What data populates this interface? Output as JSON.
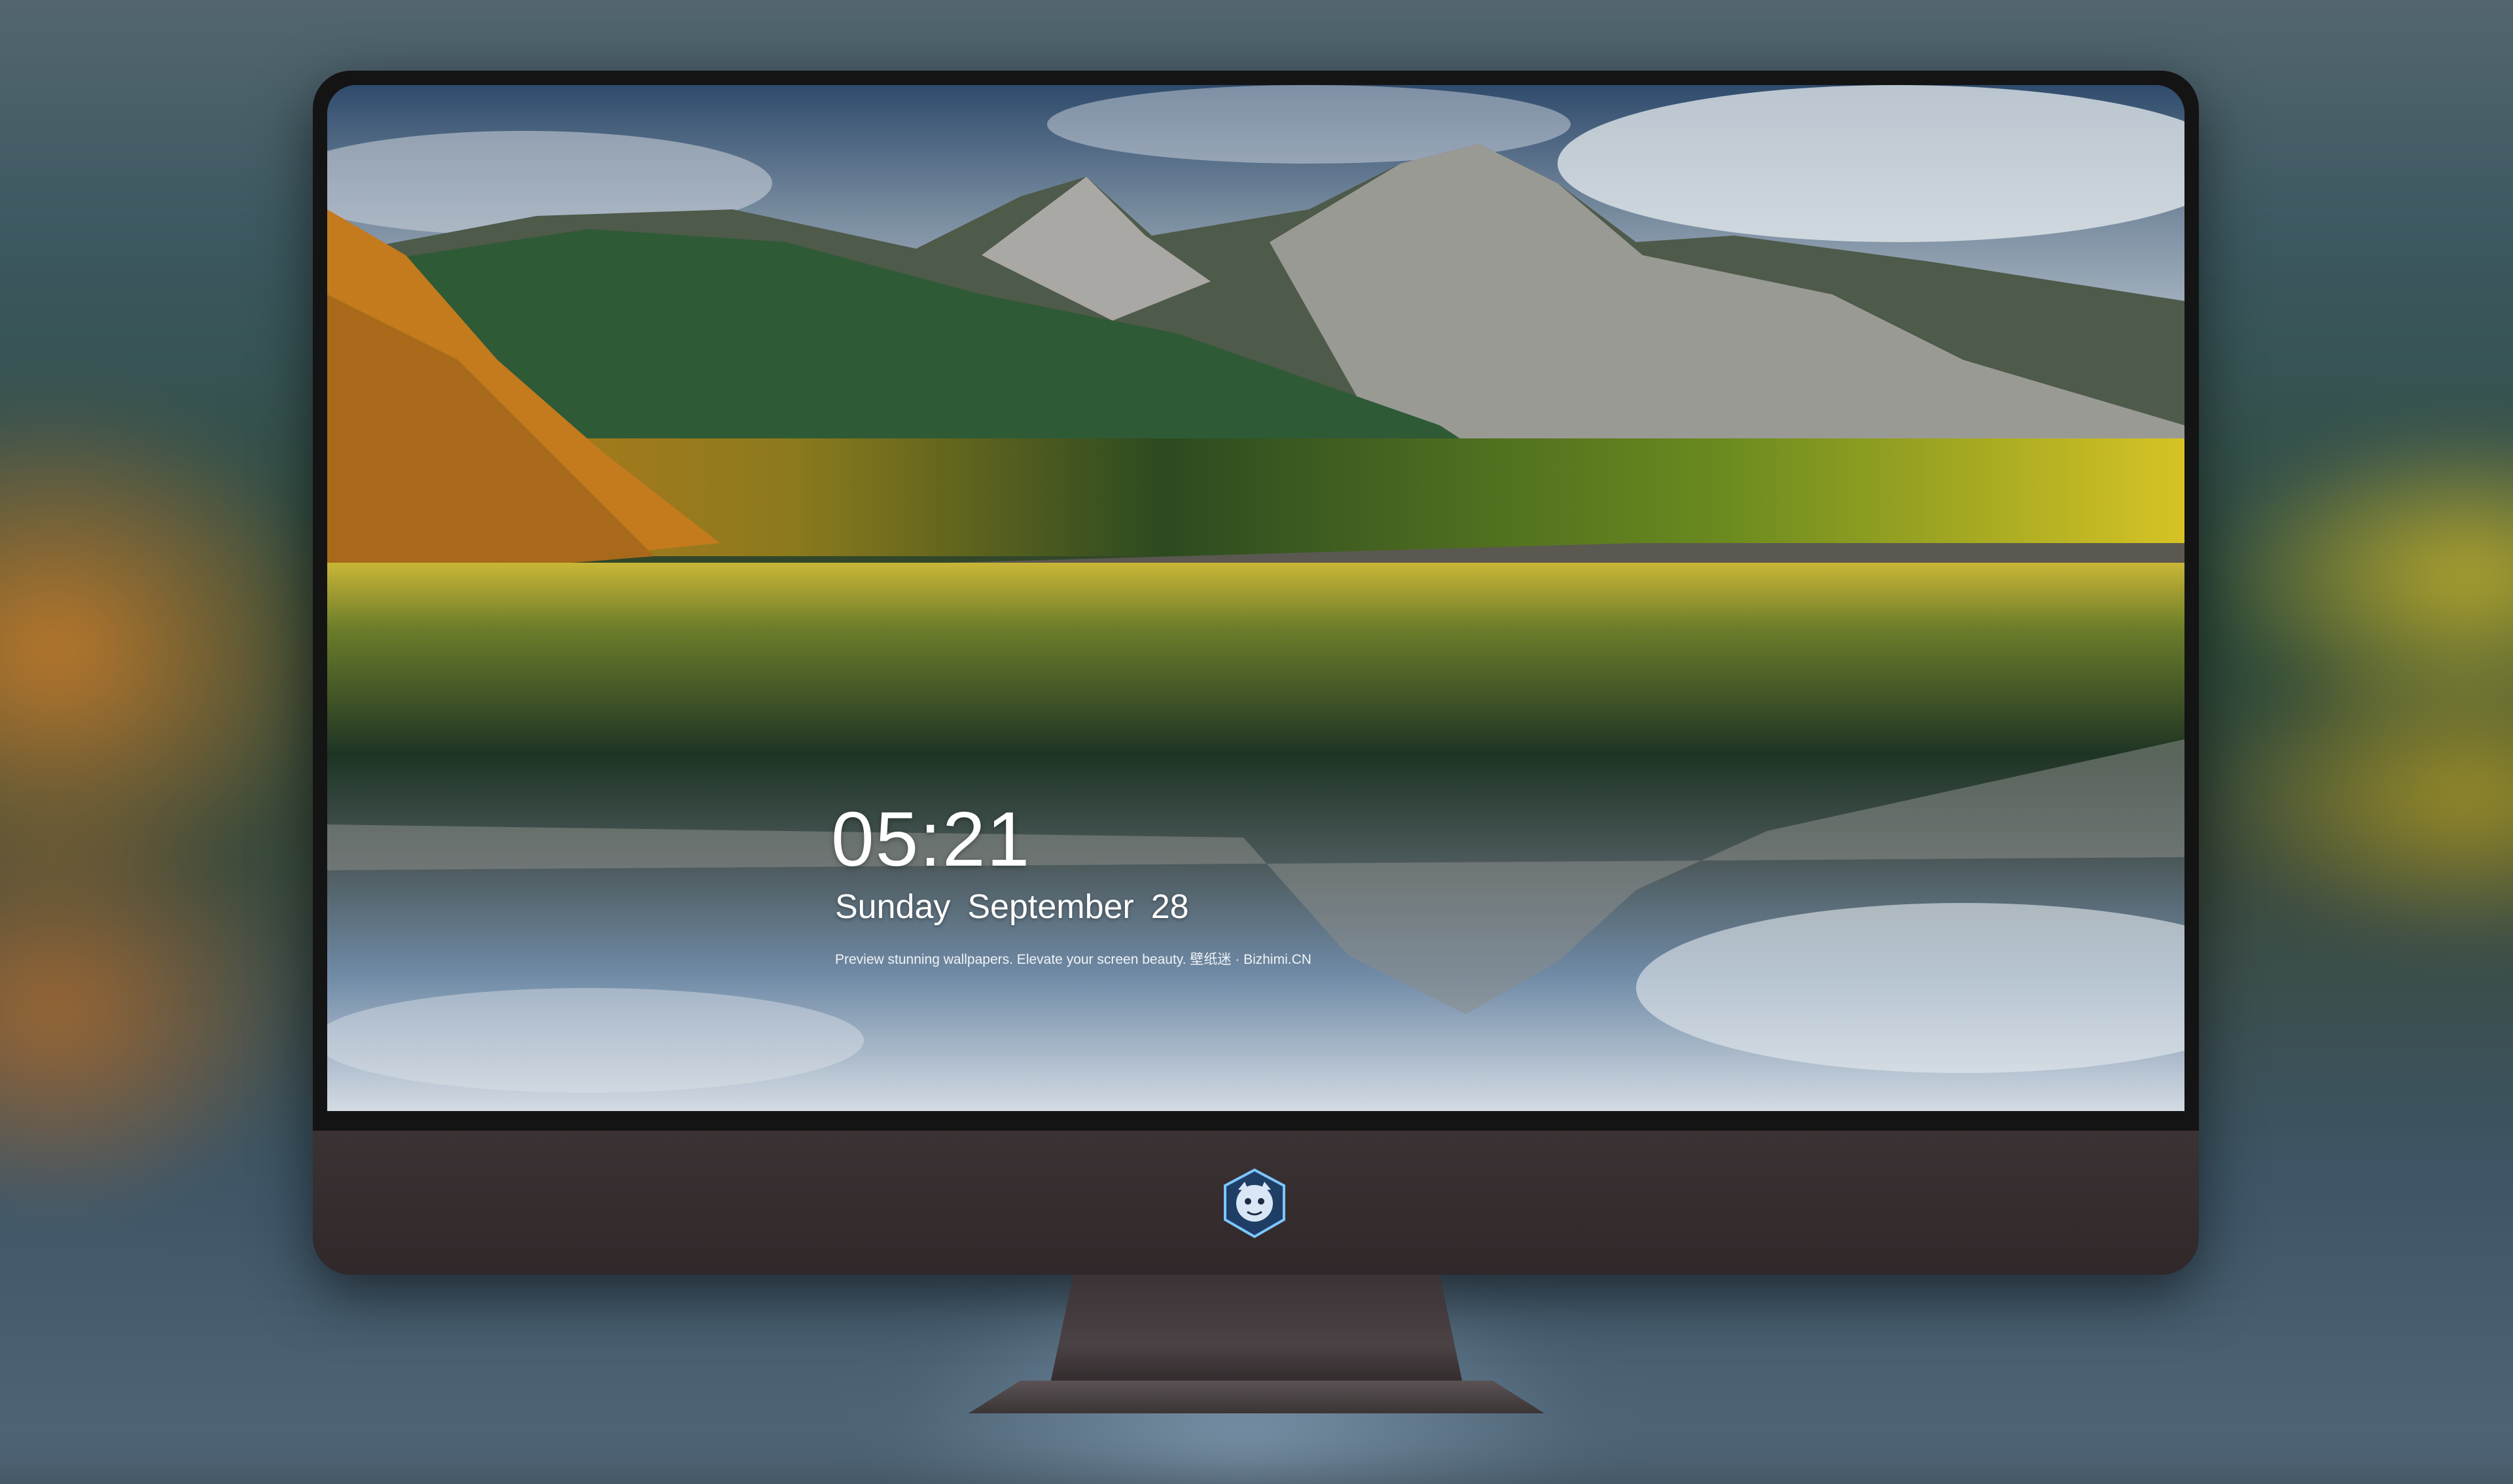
{
  "lockscreen": {
    "time": "05:21",
    "weekday": "Sunday",
    "month": "September",
    "day": "28",
    "tagline": "Preview stunning wallpapers. Elevate your screen beauty. 壁纸迷 · Bizhimi.CN"
  },
  "dock": {
    "apps": [
      {
        "name": "messages-icon",
        "color": "#3fd45a"
      },
      {
        "name": "weather-icon",
        "color": "#2a8cf0"
      },
      {
        "name": "clock-icon",
        "color": "#1c1c1c"
      },
      {
        "name": "preview-icon",
        "color": "#e8e6df"
      },
      {
        "name": "clips-icon",
        "color": "#5cc6f4"
      },
      {
        "name": "notes-icon",
        "color": "#f6d24a"
      },
      {
        "name": "photo-booth-icon",
        "color": "#e5e5e5"
      },
      {
        "name": "itunes-icon",
        "color": "#e44bc9"
      },
      {
        "name": "app-store-icon",
        "color": "#1f8ff4"
      },
      {
        "name": "camera-icon",
        "color": "#6a6a6a"
      }
    ]
  },
  "colors": {
    "bezel": "#141414",
    "chin": "#332a2c",
    "text": "#ffffff"
  }
}
